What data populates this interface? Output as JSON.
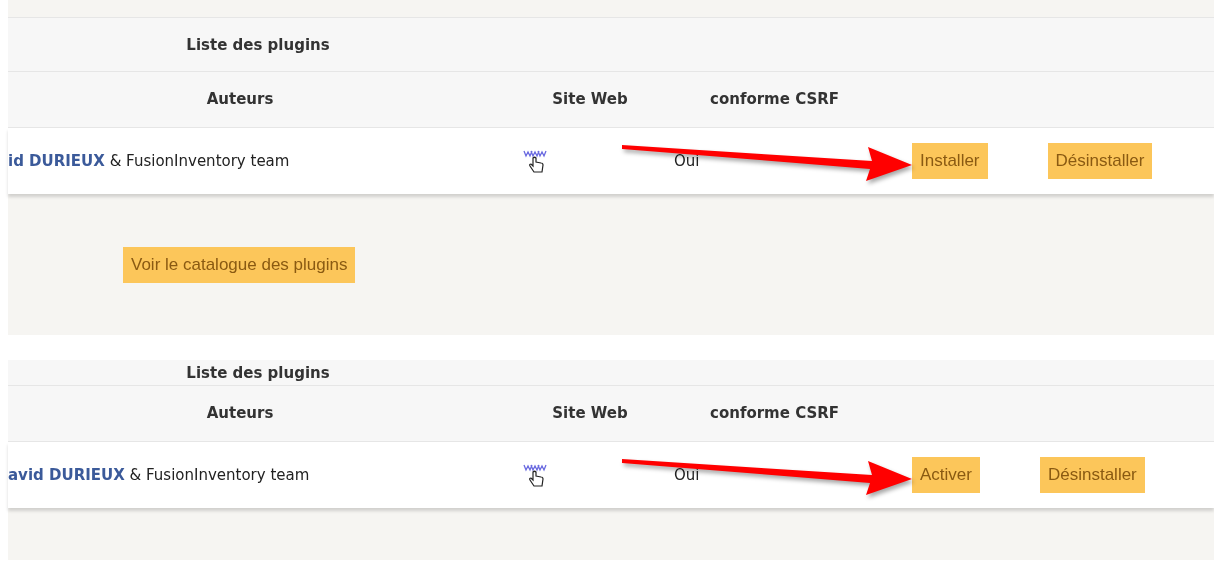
{
  "panels": [
    {
      "title": "Liste des plugins",
      "columns": [
        "Auteurs",
        "Site Web",
        "conforme CSRF"
      ],
      "row": {
        "author_link": "id DURIEUX",
        "author_rest": "& FusionInventory team",
        "csrf": "Oui",
        "actions": [
          "Installer",
          "Désinstaller"
        ]
      },
      "arrow": true,
      "catalog_button": "Voir le catalogue des plugins"
    },
    {
      "title": "Liste des plugins",
      "columns": [
        "Auteurs",
        "Site Web",
        "conforme CSRF"
      ],
      "row": {
        "author_link": "avid DURIEUX",
        "author_rest": "& FusionInventory team",
        "csrf": "Oui",
        "actions": [
          "Activer",
          "Désinstaller"
        ]
      },
      "arrow": true
    }
  ]
}
